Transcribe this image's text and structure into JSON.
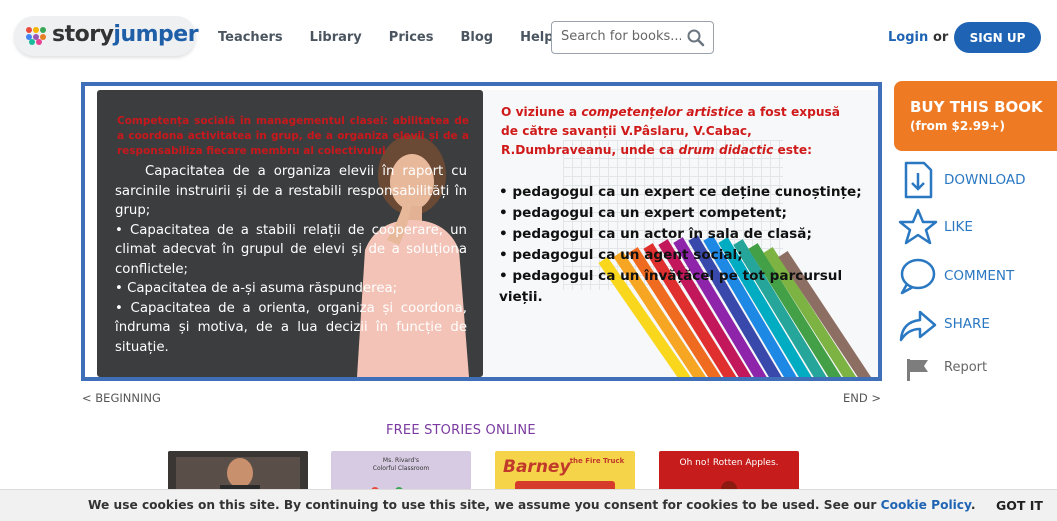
{
  "header": {
    "logo": {
      "word1": "story",
      "word2": "jumper"
    },
    "nav": [
      "Teachers",
      "Library",
      "Prices",
      "Blog",
      "Help"
    ],
    "search_placeholder": "Search for books...",
    "login": "Login",
    "or": "or",
    "signup": "SIGN UP"
  },
  "book": {
    "left_red": "Competența socială în managementul clasei: abilitatea de a coordona activitatea în grup, de a organiza elevii și de a responsabiliza fiecare membru al colectivului",
    "left_lines": [
      "Capacitatea de a organiza elevii în raport cu sarcinile instruirii și de a restabili responsabilități în grup;",
      "•    Capacitatea de a stabili relații de cooperare, un climat adecvat în grupul de elevi și de a soluționa conflictele;",
      "• Capacitatea de a-și asuma răspunderea;",
      "• Capacitatea de a orienta, organiza și coordona, îndruma și motiva, de a lua decizii în funcție de situație."
    ],
    "right_red_1": "O viziune a ",
    "right_red_italic": "competențelor artistice",
    "right_red_2": " a fost expusă de către savanții V.Pâslaru, V.Cabac, R.Dumbraveanu, unde ca ",
    "right_red_italic2": "drum didactic",
    "right_red_3": " este:",
    "right_list": [
      "• pedagogul ca un expert ce deține cunoștințe;",
      " • pedagogul ca un expert competent;",
      " • pedagogul ca un actor în sala de clasă;",
      " • pedagogul ca un agent social;",
      "• pedagogul ca un învățăcel pe tot parcursul",
      "vieții."
    ]
  },
  "side": {
    "buy_title": "BUY THIS BOOK",
    "buy_price": "(from $2.99+)",
    "download": "DOWNLOAD",
    "like": "LIKE",
    "comment": "COMMENT",
    "share": "SHARE",
    "report": "Report"
  },
  "pager": {
    "beginning": "< BEGINNING",
    "end": "END >"
  },
  "free_stories": "FREE STORIES ONLINE",
  "thumbs": {
    "b_title": "Ms. Rivard's Colorful Classroom",
    "c_title1": "Barney",
    "c_title2": "the Fire Truck",
    "d_title": "Oh no! Rotten Apples."
  },
  "cookie": {
    "message": "We use cookies on this site. By continuing to use this site, we assume you consent for cookies to be used. See our ",
    "link": "Cookie Policy",
    "period": ".",
    "button": "GOT IT"
  },
  "colors": {
    "brand_blue": "#1f64b4",
    "buy_orange": "#ef7a24",
    "action_blue": "#2a78c2",
    "free_purple": "#7a3aa0"
  }
}
